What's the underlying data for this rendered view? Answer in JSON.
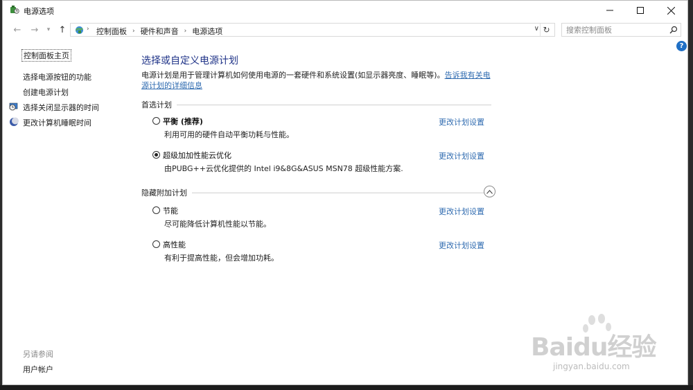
{
  "window": {
    "title": "电源选项",
    "icons": {
      "app": "power-options-icon",
      "minimize": "minimize-icon",
      "maximize": "maximize-icon",
      "close": "close-icon"
    }
  },
  "nav": {
    "breadcrumbs": [
      "控制面板",
      "硬件和声音",
      "电源选项"
    ],
    "search_placeholder": "搜索控制面板"
  },
  "sidebar": {
    "home": "控制面板主页",
    "links": [
      "选择电源按钮的功能",
      "创建电源计划",
      "选择关闭显示器的时间",
      "更改计算机睡眠时间"
    ],
    "see_also": "另请参阅",
    "user_accounts": "用户帐户"
  },
  "main": {
    "title": "选择或自定义电源计划",
    "intro_text": "电源计划是用于管理计算机如何使用电源的一套硬件和系统设置(如显示器亮度、睡眠等)。",
    "intro_link": "告诉我有关电源计划的详细信息",
    "preferred_heading": "首选计划",
    "hidden_heading": "隐藏附加计划",
    "change_label": "更改计划设置",
    "plans": [
      {
        "name": "平衡 (推荐)",
        "desc": "利用可用的硬件自动平衡功耗与性能。",
        "selected": false
      },
      {
        "name": "超级加加性能云优化",
        "desc": "由PUBG++云优化提供的 Intel i9&8G&ASUS MSN78 超级性能方案.",
        "selected": true
      },
      {
        "name": "节能",
        "desc": "尽可能降低计算机性能以节能。",
        "selected": false
      },
      {
        "name": "高性能",
        "desc": "有利于提高性能，但会增加功耗。",
        "selected": false
      }
    ]
  },
  "watermark": {
    "brand": "Baidu经验",
    "url": "jingyan.baidu.com"
  },
  "colors": {
    "title_blue": "#1e3287",
    "link_blue": "#2f6bb0",
    "help_blue": "#1f6fc5"
  }
}
